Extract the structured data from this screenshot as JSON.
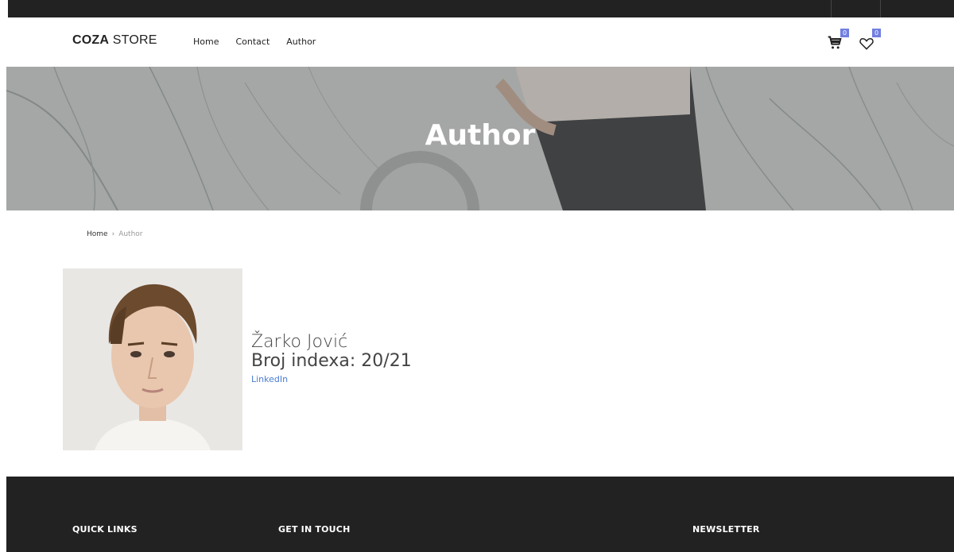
{
  "header": {
    "logo_bold": "COZA",
    "logo_light": "STORE",
    "nav": [
      {
        "label": "Home"
      },
      {
        "label": "Contact"
      },
      {
        "label": "Author"
      }
    ],
    "cart_count": "0",
    "wishlist_count": "0",
    "cart_icon": "shopping-cart-icon",
    "wishlist_icon": "heart-icon"
  },
  "banner": {
    "title": "Author"
  },
  "breadcrumb": {
    "home": "Home",
    "separator": "›",
    "current": "Author"
  },
  "author": {
    "name": "Žarko Jović",
    "index": "Broj indexa: 20/21",
    "link_label": "LinkedIn"
  },
  "footer": {
    "quick_links": "QUICK LINKS",
    "get_in_touch": "GET IN TOUCH",
    "newsletter": "NEWSLETTER"
  },
  "colors": {
    "accent": "#717fe0",
    "dark": "#222222",
    "link": "#4a7bd0"
  }
}
